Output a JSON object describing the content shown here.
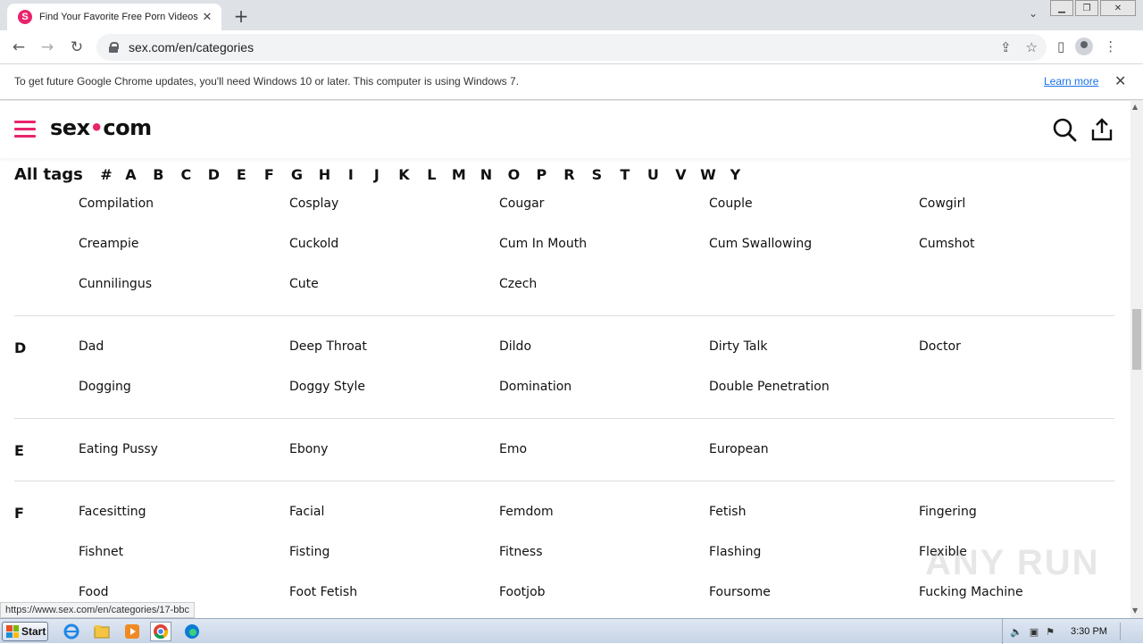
{
  "browser": {
    "tab_title": "Find Your Favorite Free Porn Videos",
    "favicon_letter": "S",
    "url": "sex.com/en/categories",
    "info_text": "To get future Google Chrome updates, you'll need Windows 10 or later. This computer is using Windows 7.",
    "info_link": "Learn more",
    "status_url": "https://www.sex.com/en/categories/17-bbc"
  },
  "site": {
    "logo_left": "sex",
    "logo_right": "com",
    "all_tags_label": "All tags",
    "letters": [
      "#",
      "A",
      "B",
      "C",
      "D",
      "E",
      "F",
      "G",
      "H",
      "I",
      "J",
      "K",
      "L",
      "M",
      "N",
      "O",
      "P",
      "R",
      "S",
      "T",
      "U",
      "V",
      "W",
      "Y"
    ]
  },
  "sections": [
    {
      "letter": "",
      "rows": [
        [
          "Compilation",
          "Cosplay",
          "Cougar",
          "Couple",
          "Cowgirl"
        ],
        [
          "Creampie",
          "Cuckold",
          "Cum In Mouth",
          "Cum Swallowing",
          "Cumshot"
        ],
        [
          "Cunnilingus",
          "Cute",
          "Czech"
        ]
      ]
    },
    {
      "letter": "D",
      "rows": [
        [
          "Dad",
          "Deep Throat",
          "Dildo",
          "Dirty Talk",
          "Doctor"
        ],
        [
          "Dogging",
          "Doggy Style",
          "Domination",
          "Double Penetration"
        ]
      ]
    },
    {
      "letter": "E",
      "rows": [
        [
          "Eating Pussy",
          "Ebony",
          "Emo",
          "European"
        ]
      ]
    },
    {
      "letter": "F",
      "rows": [
        [
          "Facesitting",
          "Facial",
          "Femdom",
          "Fetish",
          "Fingering"
        ],
        [
          "Fishnet",
          "Fisting",
          "Fitness",
          "Flashing",
          "Flexible"
        ],
        [
          "Food",
          "Foot Fetish",
          "Footjob",
          "Foursome",
          "Fucking Machine"
        ]
      ]
    }
  ],
  "taskbar": {
    "start_label": "Start",
    "clock": "3:30 PM"
  },
  "watermark": "ANY RUN",
  "colors": {
    "brand_pink": "#e8246c",
    "link_blue": "#1a73e8"
  },
  "icons": [
    "search-icon",
    "upload-icon",
    "hamburger-icon",
    "lock-icon",
    "share-icon",
    "star-icon",
    "profile-icon"
  ]
}
